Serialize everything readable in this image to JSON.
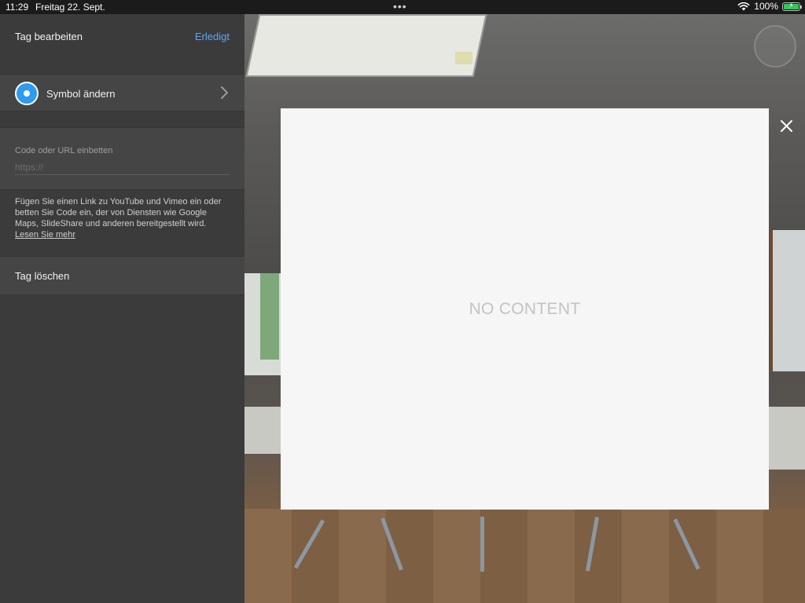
{
  "status_bar": {
    "time": "11:29",
    "date": "Freitag 22. Sept.",
    "dots": "•••",
    "battery": "100%",
    "icons": [
      "wifi-icon",
      "battery-icon"
    ],
    "battery_color": "#34c759"
  },
  "sidebar": {
    "title": "Tag bearbeiten",
    "done_label": "Erledigt",
    "symbol_label": "Symbol ändern",
    "embed_label": "Code oder URL einbetten",
    "embed_placeholder": "https://",
    "embed_value": "",
    "help_text": "Fügen Sie einen Link zu YouTube und Vimeo ein oder betten Sie Code ein, der von Diensten wie Google Maps, SlideShare und anderen bereitgestellt wird.",
    "help_link": "Lesen Sie mehr",
    "delete_label": "Tag löschen"
  },
  "modal": {
    "placeholder": "NO CONTENT"
  },
  "colors": {
    "accent": "#5aa6ff",
    "symbol": "#2e9bf0",
    "sidebar_bg": "#3b3b3b",
    "row_bg": "#454545"
  }
}
